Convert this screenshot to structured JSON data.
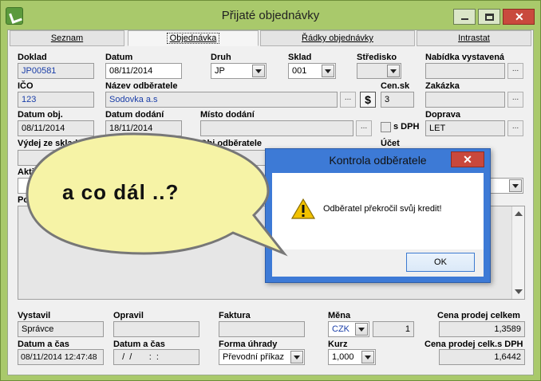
{
  "window": {
    "title": "Přijaté objednávky"
  },
  "tabs": [
    {
      "label": "Seznam"
    },
    {
      "label": "Objednávka"
    },
    {
      "label": "Řádky objednávky"
    },
    {
      "label": "Intrastat"
    }
  ],
  "form": {
    "doklad": {
      "label": "Doklad",
      "value": "JP00581"
    },
    "datum": {
      "label": "Datum",
      "value": "08/11/2014"
    },
    "druh": {
      "label": "Druh",
      "value": "JP"
    },
    "sklad": {
      "label": "Sklad",
      "value": "001"
    },
    "stredisko": {
      "label": "Středisko",
      "value": ""
    },
    "nabidka": {
      "label": "Nabídka vystavená",
      "value": ""
    },
    "ico": {
      "label": "IČO",
      "value": "123"
    },
    "nazev": {
      "label": "Název odběratele",
      "value": "Sodovka a.s"
    },
    "dollar_symbol": "$",
    "censk": {
      "label": "Cen.sk",
      "value": "3"
    },
    "zakazka": {
      "label": "Zakázka",
      "value": ""
    },
    "datum_obj": {
      "label": "Datum obj.",
      "value": "08/11/2014"
    },
    "datum_dodani": {
      "label": "Datum dodání",
      "value": "18/11/2014"
    },
    "misto_dodani": {
      "label": "Místo dodání",
      "value": ""
    },
    "s_dph": {
      "label": "s DPH"
    },
    "doprava": {
      "label": "Doprava",
      "value": "LET"
    },
    "vydej": {
      "label": "Výdej ze sklad"
    },
    "obj_odberatele": {
      "label": "Obj.odběratele"
    },
    "ucet": {
      "label": "Účet"
    },
    "aktivita": {
      "label": "Aktiv"
    },
    "o_partial": {
      "label": "o"
    },
    "poznamka": {
      "label": "Poz"
    },
    "vystavil": {
      "label": "Vystavil",
      "value": "Správce"
    },
    "opravil": {
      "label": "Opravil",
      "value": ""
    },
    "faktura": {
      "label": "Faktura",
      "value": ""
    },
    "mena": {
      "label": "Měna",
      "value": "CZK",
      "rate_qty": "1"
    },
    "cena_celkem": {
      "label": "Cena prodej celkem",
      "value": "1,3589"
    },
    "datum_cas_1": {
      "label": "Datum a čas",
      "value": "08/11/2014 12:47:48"
    },
    "datum_cas_2": {
      "label": "Datum a čas",
      "value": "  /  /       :  :  "
    },
    "forma_uhrady": {
      "label": "Forma úhrady",
      "value": "Převodní příkaz"
    },
    "kurz": {
      "label": "Kurz",
      "value": "1,000"
    },
    "cena_dph": {
      "label": "Cena prodej celk.s DPH",
      "value": "1,6442"
    }
  },
  "ellipsis": "...",
  "dialog": {
    "title": "Kontrola odběratele",
    "message": "Odběratel překročil svůj kredit!",
    "ok_label": "OK",
    "close_glyph": "✕"
  },
  "bubble": {
    "text": "a co dál ..?"
  },
  "colors": {
    "window_frame": "#a9c96b",
    "dialog_frame": "#3d7ad6",
    "bubble_fill": "#f6f3a6",
    "value_blue": "#1a3ea8"
  }
}
